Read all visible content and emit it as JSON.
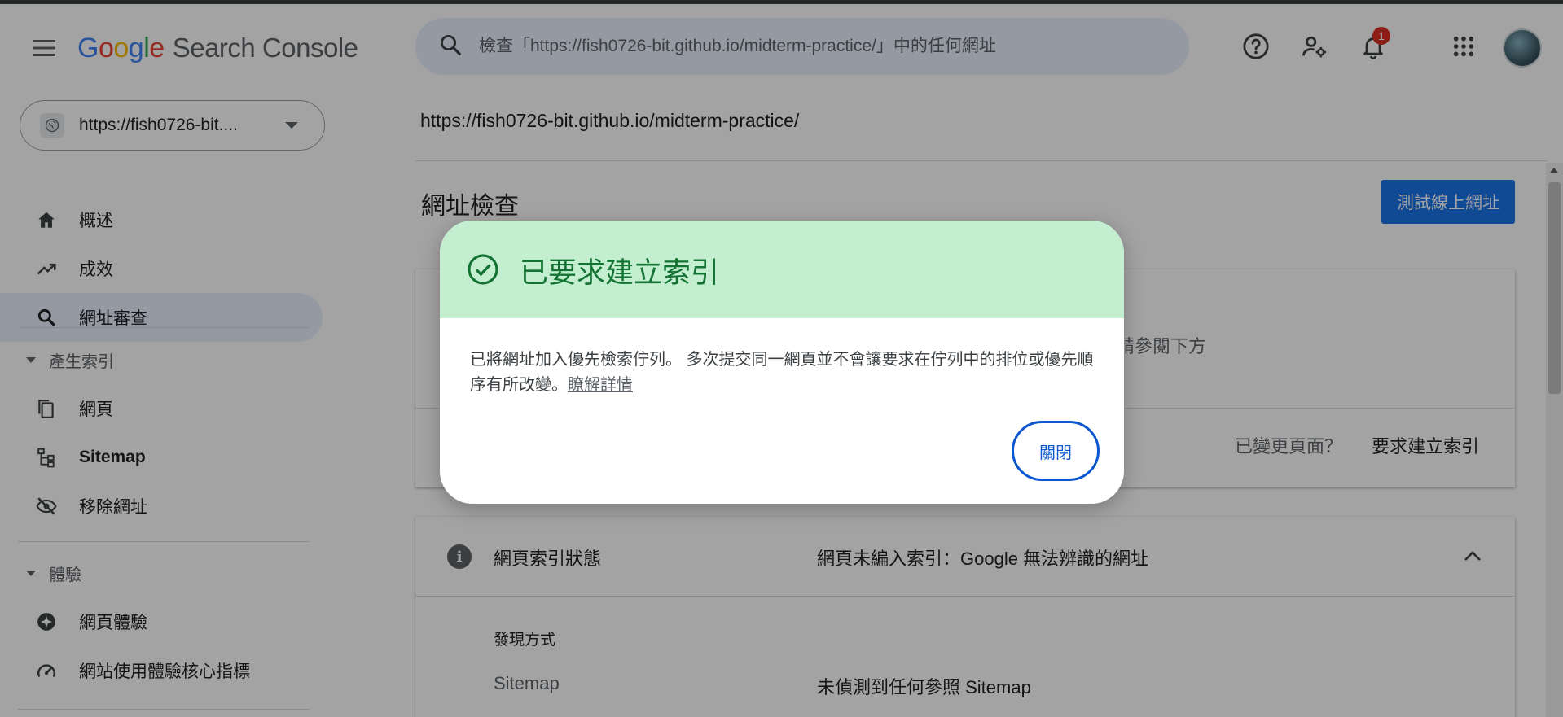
{
  "header": {
    "logo_letters": [
      "G",
      "o",
      "o",
      "g",
      "l",
      "e"
    ],
    "product_name": "Search Console",
    "search_placeholder": "檢查「https://fish0726-bit.github.io/midterm-practice/」中的任何網址",
    "notification_count": "1",
    "icons": [
      "menu-icon",
      "search-icon",
      "help-icon",
      "manage-users-icon",
      "notifications-icon",
      "apps-grid-icon",
      "avatar"
    ]
  },
  "sidebar": {
    "property": "https://fish0726-bit....",
    "items": [
      {
        "label": "概述",
        "icon": "home-icon"
      },
      {
        "label": "成效",
        "icon": "trending-up-icon"
      },
      {
        "label": "網址審查",
        "icon": "search-icon"
      }
    ],
    "section_indexing": "產生索引",
    "indexing_items": [
      {
        "label": "網頁",
        "icon": "pages-icon"
      },
      {
        "label": "Sitemap",
        "icon": "sitemap-icon"
      },
      {
        "label": "移除網址",
        "icon": "visibility-off-icon"
      }
    ],
    "section_experience": "體驗",
    "experience_items": [
      {
        "label": "網頁體驗",
        "icon": "page-experience-icon"
      },
      {
        "label": "網站使用體驗核心指標",
        "icon": "speed-icon"
      }
    ]
  },
  "main": {
    "url": "https://fish0726-bit.github.io/midterm-practice/",
    "title": "網址檢查",
    "test_live_button": "測試線上網址",
    "card1": {
      "partial_text": "請參閱下方",
      "changed_page": "已變更頁面？",
      "request_indexing": "要求建立索引"
    },
    "card2": {
      "title": "網頁索引狀態",
      "status": "網頁未編入索引：Google 無法辨識的網址",
      "discovery_heading": "發現方式",
      "sitemap_label": "Sitemap",
      "sitemap_value": "未偵測到任何參照 Sitemap"
    }
  },
  "dialog": {
    "title": "已要求建立索引",
    "body": "已將網址加入優先檢索佇列。 多次提交同一網頁並不會讓要求在佇列中的排位或優先順序有所改變。",
    "learn_more": "瞭解詳情",
    "close_button": "關閉"
  },
  "colors": {
    "dialog_header_bg": "#c4eed0",
    "dialog_title": "#137333",
    "accent_blue": "#1a73e8",
    "close_outline": "#0b57d0",
    "badge_red": "#d93025"
  }
}
